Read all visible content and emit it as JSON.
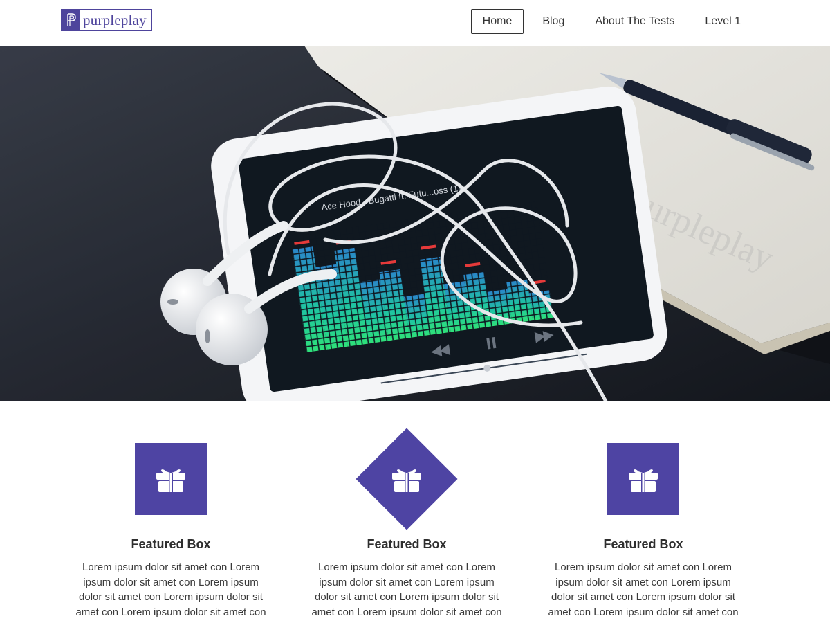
{
  "brand": {
    "logo_text": "purpleplay",
    "logo_mark": "P",
    "color": "#4e44a3"
  },
  "nav": {
    "items": [
      {
        "label": "Home",
        "active": true
      },
      {
        "label": "Blog",
        "active": false
      },
      {
        "label": "About The Tests",
        "active": false
      },
      {
        "label": "Level 1",
        "active": false
      }
    ]
  },
  "hero": {
    "phone_track": "Ace Hood - Bugatti ft. Futu...oss (1)",
    "watermark": "purpleplay"
  },
  "features": [
    {
      "icon": "gift-icon",
      "shape": "square",
      "title": "Featured Box",
      "text": "Lorem ipsum dolor sit amet con Lorem ipsum dolor sit amet con Lorem ipsum dolor sit amet con Lorem ipsum dolor sit amet con Lorem ipsum dolor sit amet con"
    },
    {
      "icon": "gift-icon",
      "shape": "diamond",
      "title": "Featured Box",
      "text": "Lorem ipsum dolor sit amet con Lorem ipsum dolor sit amet con Lorem ipsum dolor sit amet con Lorem ipsum dolor sit amet con Lorem ipsum dolor sit amet con"
    },
    {
      "icon": "gift-icon",
      "shape": "square",
      "title": "Featured Box",
      "text": "Lorem ipsum dolor sit amet con Lorem ipsum dolor sit amet con Lorem ipsum dolor sit amet con Lorem ipsum dolor sit amet con Lorem ipsum dolor sit amet con"
    }
  ]
}
